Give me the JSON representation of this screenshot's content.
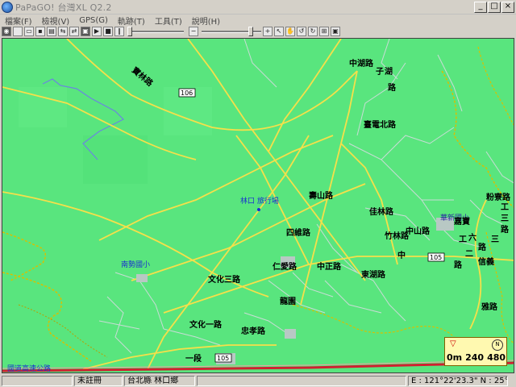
{
  "window": {
    "title": "PaPaGO! 台灣XL Q2.2",
    "minimize": "_",
    "maximize": "□",
    "close": "×"
  },
  "menu": [
    {
      "label": "檔案(F)"
    },
    {
      "label": "檢視(V)"
    },
    {
      "label": "GPS(G)"
    },
    {
      "label": "軌跡(T)"
    },
    {
      "label": "工具(T)"
    },
    {
      "label": "說明(H)"
    }
  ],
  "toolbar": {
    "zoom_out_glyph": "−",
    "zoom_in_glyph": "+",
    "speed_slider_level": 0.0,
    "zoom_slider_level": 0.85
  },
  "map": {
    "colors": {
      "land": "#59e57e",
      "road": "#f5e04a",
      "minor_road": "#c9dcd6",
      "contour": "#b8a000",
      "river": "#6a86e0"
    },
    "road_labels": [
      "中湖路",
      "子",
      "湖",
      "路",
      "臺電北路",
      "佳林路",
      "中山路",
      "四維路",
      "中正路",
      "仁愛路",
      "文化三路",
      "文化一路",
      "忠孝路",
      "一段",
      "東湖路",
      "竹林路",
      "中",
      "六",
      "路",
      "工",
      "二",
      "路",
      "粉寮路",
      "工",
      "三",
      "路",
      "三",
      "信義",
      "雅路",
      "壽山路",
      "嘉寶"
    ],
    "route_shields": [
      "106",
      "105",
      "105"
    ],
    "poi": [
      {
        "name": "林口 旅行場"
      },
      {
        "name": "南勢國小"
      },
      {
        "name": "華新國小"
      },
      {
        "name": "龍園"
      },
      {
        "name": "寶林路"
      }
    ],
    "bottom_road": "國道高速公路",
    "scale": {
      "numbers": [
        "0m",
        "240",
        "480"
      ]
    }
  },
  "status": {
    "left": "",
    "reg": "未註冊",
    "region": "台北縣 林口鄉",
    "coords": "E : 121°22'23.3\"  N : 25°04'58.1\""
  }
}
